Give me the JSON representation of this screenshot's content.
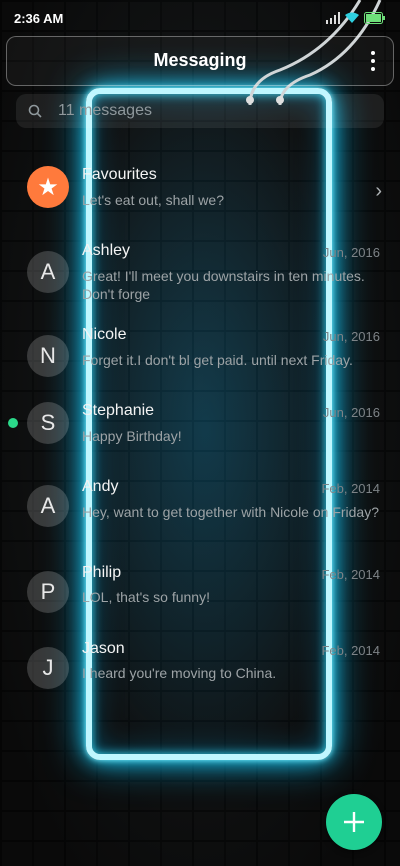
{
  "status": {
    "time": "2:36 AM"
  },
  "header": {
    "title": "Messaging"
  },
  "search": {
    "placeholder": "11 messages"
  },
  "favourites": {
    "name": "Favourites",
    "preview": "Let's eat out, shall we?"
  },
  "conversations": [
    {
      "initial": "A",
      "name": "Ashley",
      "date": "Jun, 2016",
      "preview": "Great! I'll meet you downstairs in ten minutes. Don't forge",
      "unread": false
    },
    {
      "initial": "N",
      "name": "Nicole",
      "date": "Jun, 2016",
      "preview": "Forget it.I don't bl get paid. until next Friday.",
      "unread": false
    },
    {
      "initial": "S",
      "name": "Stephanie",
      "date": "Jun, 2016",
      "preview": "Happy Birthday!",
      "unread": true
    },
    {
      "initial": "A",
      "name": "Andy",
      "date": "Feb, 2014",
      "preview": "Hey, want to get together with Nicole on Friday?",
      "unread": false
    },
    {
      "initial": "P",
      "name": "Philip",
      "date": "Feb, 2014",
      "preview": "LOL, that's so funny!",
      "unread": false
    },
    {
      "initial": "J",
      "name": "Jason",
      "date": "Feb, 2014",
      "preview": "I heard you're moving to China.",
      "unread": false
    }
  ],
  "colors": {
    "neon": "#23c6e8",
    "fab": "#1fcf93",
    "favourite": "#ff7a3c",
    "unread_dot": "#2bd98a"
  },
  "icons": {
    "search": "search-icon",
    "more": "more-vertical-icon",
    "chevron": "chevron-right-icon",
    "star": "star-icon",
    "add": "plus-icon"
  }
}
